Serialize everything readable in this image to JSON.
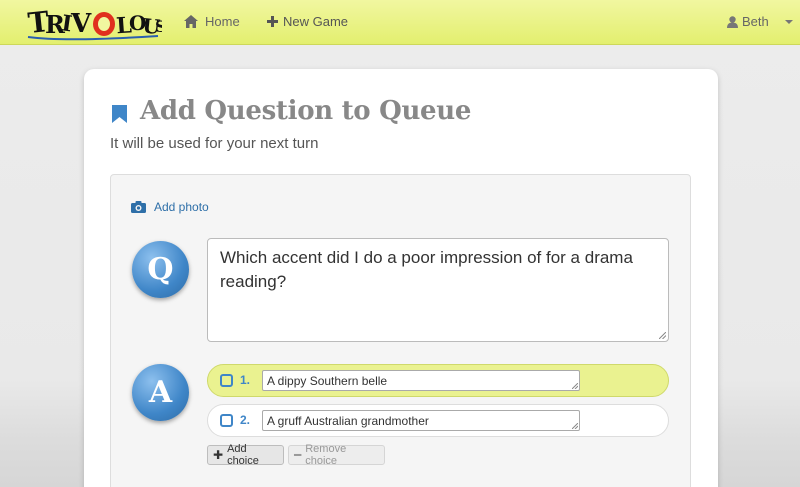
{
  "navbar": {
    "logo_text": "TRIVOLOUS",
    "home_label": "Home",
    "new_game_label": "New Game",
    "user_name": "Beth",
    "background": "#e6f07a"
  },
  "page": {
    "title": "Add Question to Queue",
    "subtitle": "It will be used for your next turn"
  },
  "form": {
    "add_photo_label": "Add photo",
    "question_badge": "Q",
    "answer_badge": "A",
    "question_text": "Which accent did I do a poor impression of for a drama reading?",
    "choices": [
      {
        "number": "1.",
        "text": "A dippy Southern belle",
        "selected": true
      },
      {
        "number": "2.",
        "text": "A gruff Australian grandmother",
        "selected": false
      }
    ],
    "add_choice_label": "Add choice",
    "remove_choice_label": "Remove choice",
    "accent_color": "#3f86c8",
    "selected_color": "#eaf290"
  }
}
